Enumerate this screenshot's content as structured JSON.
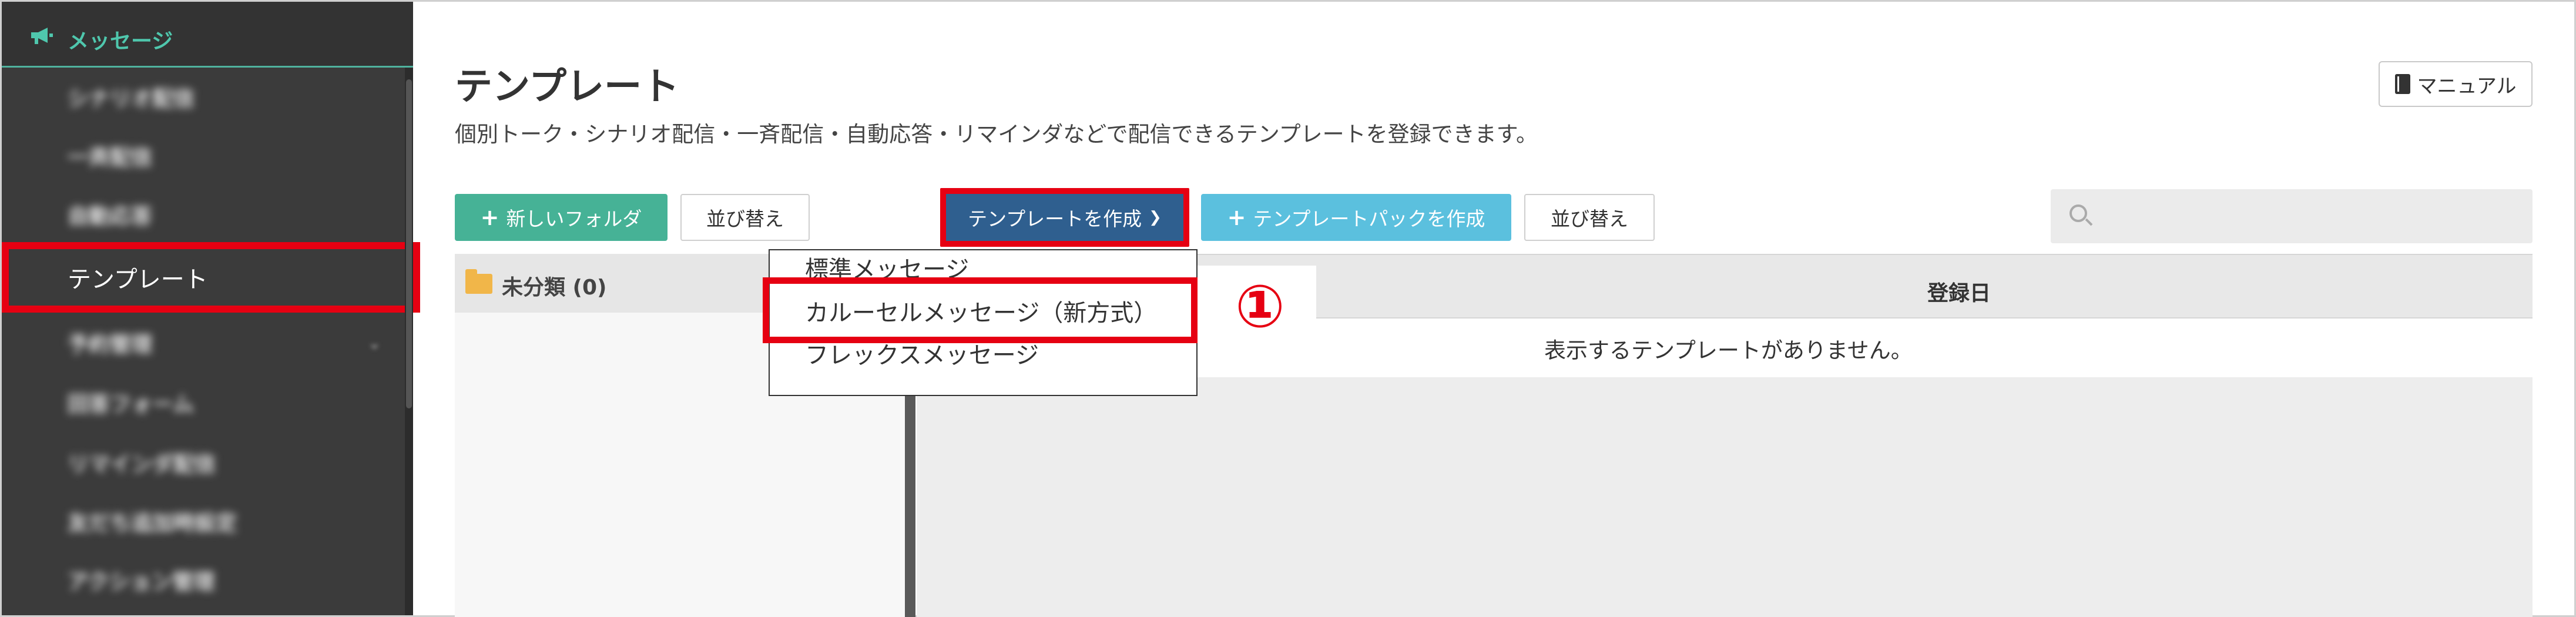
{
  "sidebar": {
    "header": "メッセージ",
    "items": [
      {
        "label": "シナリオ配信"
      },
      {
        "label": "一斉配信"
      },
      {
        "label": "自動応答"
      },
      {
        "label": "テンプレート"
      },
      {
        "label": "予約管理"
      },
      {
        "label": "回答フォーム"
      },
      {
        "label": "リマインダ配信"
      },
      {
        "label": "友だち追加時設定"
      },
      {
        "label": "アクション管理"
      }
    ]
  },
  "header": {
    "title": "テンプレート",
    "description": "個別トーク・シナリオ配信・一斉配信・自動応答・リマインダなどで配信できるテンプレートを登録できます。",
    "manual_label": "マニュアル"
  },
  "toolbar": {
    "new_folder_label": "新しいフォルダ",
    "sort_label_1": "並び替え",
    "create_template_label": "テンプレートを作成",
    "create_pack_label": "テンプレートパックを作成",
    "sort_label_2": "並び替え",
    "search_placeholder": ""
  },
  "folders": {
    "uncategorized_label": "未分類 (0)"
  },
  "table": {
    "date_header": "登録日",
    "empty_message": "表示するテンプレートがありません。"
  },
  "dropdown": {
    "items": [
      {
        "label": "標準メッセージ"
      },
      {
        "label": "カルーセルメッセージ（新方式）"
      },
      {
        "label": "フレックスメッセージ"
      }
    ]
  },
  "annotation": {
    "step": "①"
  },
  "colors": {
    "accent_green": "#46b296",
    "create_blue": "#2f5f8f",
    "pack_blue": "#5bc0de",
    "highlight_red": "#e60012"
  }
}
